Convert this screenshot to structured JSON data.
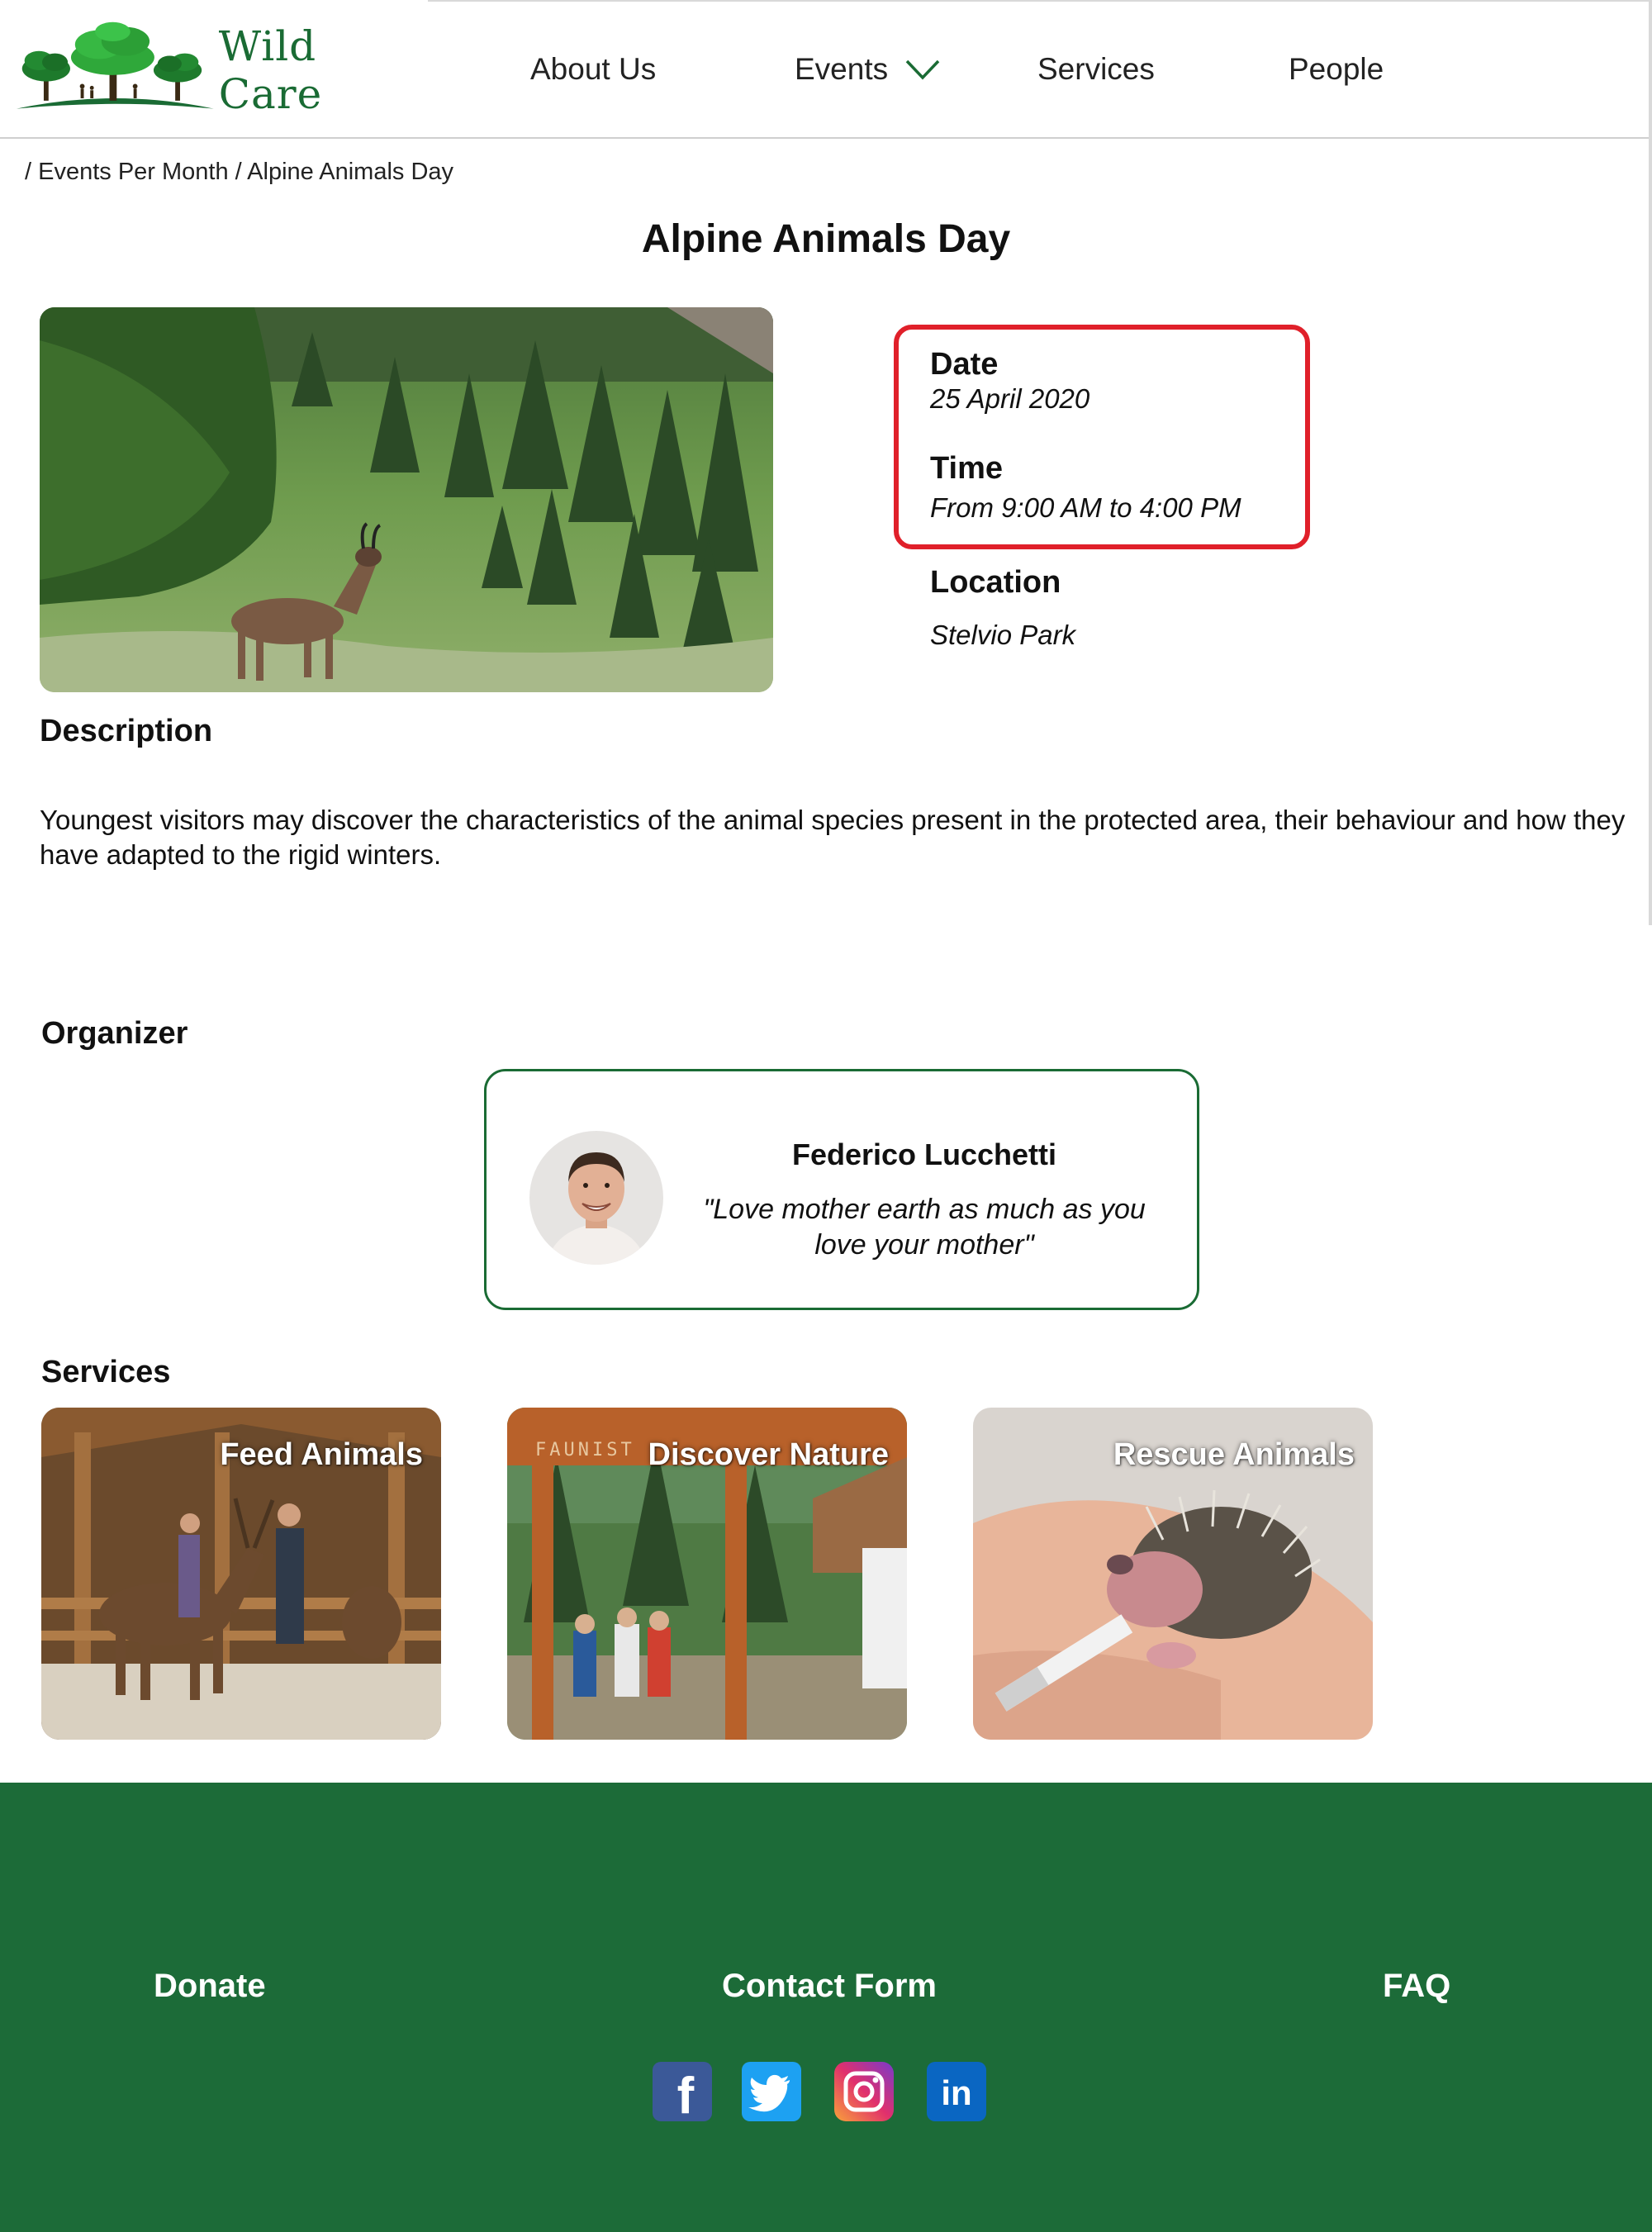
{
  "brand": {
    "name": "Wild Care",
    "color": "#1a6b34"
  },
  "nav": {
    "about": "About Us",
    "events": "Events",
    "services": "Services",
    "people": "People"
  },
  "breadcrumb": "/ Events Per Month / Alpine Animals Day",
  "event": {
    "title": "Alpine Animals Day",
    "date_label": "Date",
    "date": "25 April 2020",
    "time_label": "Time",
    "time": "From 9:00 AM to 4:00 PM",
    "location_label": "Location",
    "location": "Stelvio Park",
    "highlight_color": "#e0202a"
  },
  "description": {
    "heading": "Description",
    "text": "Youngest visitors may discover the characteristics of the animal species present in the protected area, their behaviour and how they have adapted to the rigid winters."
  },
  "organizer": {
    "heading": "Organizer",
    "name": "Federico Lucchetti",
    "quote": "\"Love mother earth as much as you love your mother\""
  },
  "services": {
    "heading": "Services",
    "items": [
      {
        "label": "Feed Animals"
      },
      {
        "label": "Discover Nature"
      },
      {
        "label": "Rescue Animals"
      }
    ],
    "sign_text": "FAUNIST"
  },
  "footer": {
    "background": "#1c6b38",
    "donate": "Donate",
    "contact": "Contact Form",
    "faq": "FAQ",
    "social": [
      {
        "icon": "facebook-icon",
        "glyph": "f"
      },
      {
        "icon": "twitter-icon"
      },
      {
        "icon": "instagram-icon"
      },
      {
        "icon": "linkedin-icon",
        "glyph": "in"
      }
    ]
  }
}
